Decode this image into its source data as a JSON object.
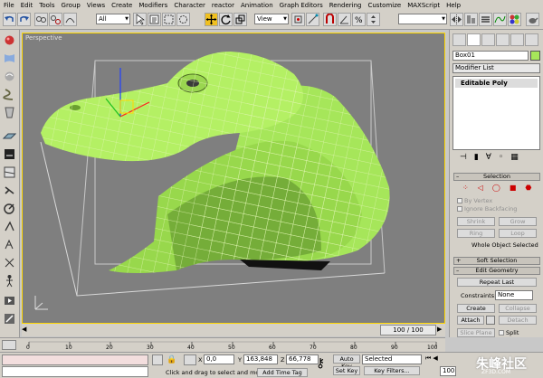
{
  "menu": [
    "File",
    "Edit",
    "Tools",
    "Group",
    "Views",
    "Create",
    "Modifiers",
    "Character",
    "reactor",
    "Animation",
    "Graph Editors",
    "Rendering",
    "Customize",
    "MAXScript",
    "Help"
  ],
  "toolbar": {
    "filter_value": "All",
    "refcoord_value": "View"
  },
  "viewport": {
    "label": "Perspective",
    "frame_counter": "100 / 100"
  },
  "command_panel": {
    "object_name": "Box01",
    "modifier_list": "Modifier List",
    "stack_item": "Editable Poly",
    "selection_header": "Selection",
    "by_vertex": "By Vertex",
    "ignore_backfacing": "Ignore Backfacing",
    "shrink": "Shrink",
    "grow": "Grow",
    "ring": "Ring",
    "loop": "Loop",
    "selected_status": "Whole Object Selected",
    "soft_selection": "Soft Selection",
    "edit_geometry": "Edit Geometry",
    "repeat_last": "Repeat Last",
    "constraints_label": "Constraints:",
    "constraints_value": "None",
    "create": "Create",
    "collapse": "Collapse",
    "attach": "Attach",
    "detach": "Detach",
    "slice_plane": "Slice Plane",
    "split": "Split"
  },
  "timeline": {
    "ticks": [
      "0",
      "10",
      "20",
      "30",
      "40",
      "50",
      "60",
      "70",
      "80",
      "90",
      "100"
    ]
  },
  "status": {
    "prompt": "Click and drag to select and move",
    "add_time_tag": "Add Time Tag",
    "x_label": "X",
    "x_value": "0,0",
    "y_label": "Y",
    "y_value": "163,848",
    "z_label": "Z",
    "z_value": "66,778",
    "auto_key": "Auto Key",
    "set_key": "Set Key",
    "key_mode": "Selected",
    "key_filters": "Key Filters...",
    "frame": "100"
  },
  "watermark": "朱峰社区",
  "watermark_url": "ZF3D.COM",
  "colors": {
    "mesh": "#a6e65a",
    "mesh_dark": "#5a8a2a",
    "viewport_bg": "#7f7f7f",
    "ui": "#d4d0c8",
    "active_border": "#ffd700",
    "stack_highlight": "#dcdcdc"
  }
}
